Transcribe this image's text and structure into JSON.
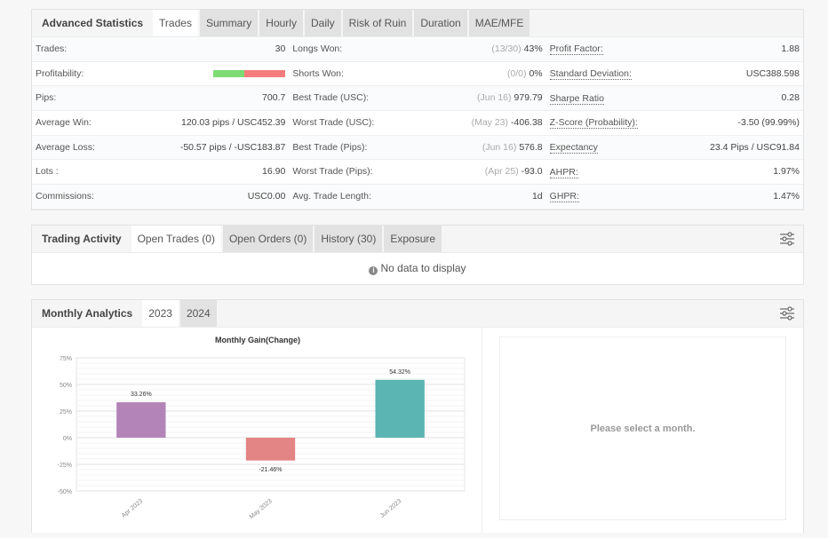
{
  "stats": {
    "title": "Advanced Statistics",
    "tabs": [
      {
        "label": "Trades",
        "active": true
      },
      {
        "label": "Summary"
      },
      {
        "label": "Hourly"
      },
      {
        "label": "Daily"
      },
      {
        "label": "Risk of Ruin"
      },
      {
        "label": "Duration"
      },
      {
        "label": "MAE/MFE"
      }
    ],
    "col1": [
      {
        "label": "Trades:",
        "value": "30"
      },
      {
        "label": "Profitability:",
        "profit_fraction": 0.43
      },
      {
        "label": "Pips:",
        "value": "700.7"
      },
      {
        "label": "Average Win:",
        "value": "120.03 pips / USC452.39"
      },
      {
        "label": "Average Loss:",
        "value": "-50.57 pips / -USC183.87"
      },
      {
        "label": "Lots :",
        "value": "16.90"
      },
      {
        "label": "Commissions:",
        "value": "USC0.00"
      }
    ],
    "col2": [
      {
        "label": "Longs Won:",
        "sub": "(13/30)",
        "value": "43%"
      },
      {
        "label": "Shorts Won:",
        "sub": "(0/0)",
        "value": "0%"
      },
      {
        "label": "Best Trade (USC):",
        "sub": "(Jun 16)",
        "value": "979.79"
      },
      {
        "label": "Worst Trade (USC):",
        "sub": "(May 23)",
        "value": "-406.38"
      },
      {
        "label": "Best Trade (Pips):",
        "sub": "(Jun 16)",
        "value": "576.8"
      },
      {
        "label": "Worst Trade (Pips):",
        "sub": "(Apr 25)",
        "value": "-93.0"
      },
      {
        "label": "Avg. Trade Length:",
        "sub": "",
        "value": "1d"
      }
    ],
    "col3": [
      {
        "label": "Profit Factor:",
        "value": "1.88"
      },
      {
        "label": "Standard Deviation:",
        "value": "USC388.598"
      },
      {
        "label": "Sharpe Ratio",
        "value": "0.28"
      },
      {
        "label": "Z-Score (Probability):",
        "value": "-3.50 (99.99%)"
      },
      {
        "label": "Expectancy",
        "value": "23.4 Pips / USC91.84"
      },
      {
        "label": "AHPR:",
        "value": "1.97%"
      },
      {
        "label": "GHPR:",
        "value": "1.47%"
      }
    ]
  },
  "activity": {
    "title": "Trading Activity",
    "tabs": [
      {
        "label": "Open Trades (0)",
        "active": true
      },
      {
        "label": "Open Orders (0)"
      },
      {
        "label": "History (30)"
      },
      {
        "label": "Exposure"
      }
    ],
    "empty_message": "No data to display"
  },
  "monthly": {
    "title": "Monthly Analytics",
    "tabs": [
      {
        "label": "2023",
        "active": true
      },
      {
        "label": "2024"
      }
    ],
    "select_message": "Please select a month."
  },
  "colors": {
    "profit_green": "#7dda74",
    "loss_red": "#f47c7c"
  },
  "chart_data": {
    "type": "bar",
    "title": "Monthly Gain(Change)",
    "categories": [
      "Apr 2023",
      "May 2023",
      "Jun 2023"
    ],
    "values": [
      33.26,
      -21.46,
      54.32
    ],
    "data_labels": [
      "33.26%",
      "-21.46%",
      "54.32%"
    ],
    "bar_colors": [
      "#b384b8",
      "#e38585",
      "#5ab5b3"
    ],
    "xlabel": "",
    "ylabel": "",
    "ylim": [
      -50,
      75
    ],
    "yticks": [
      75,
      50,
      25,
      0,
      -25,
      -50
    ],
    "ytick_labels": [
      "75%",
      "50%",
      "25%",
      "0%",
      "-25%",
      "-50%"
    ],
    "grid": true,
    "legend": "none"
  }
}
